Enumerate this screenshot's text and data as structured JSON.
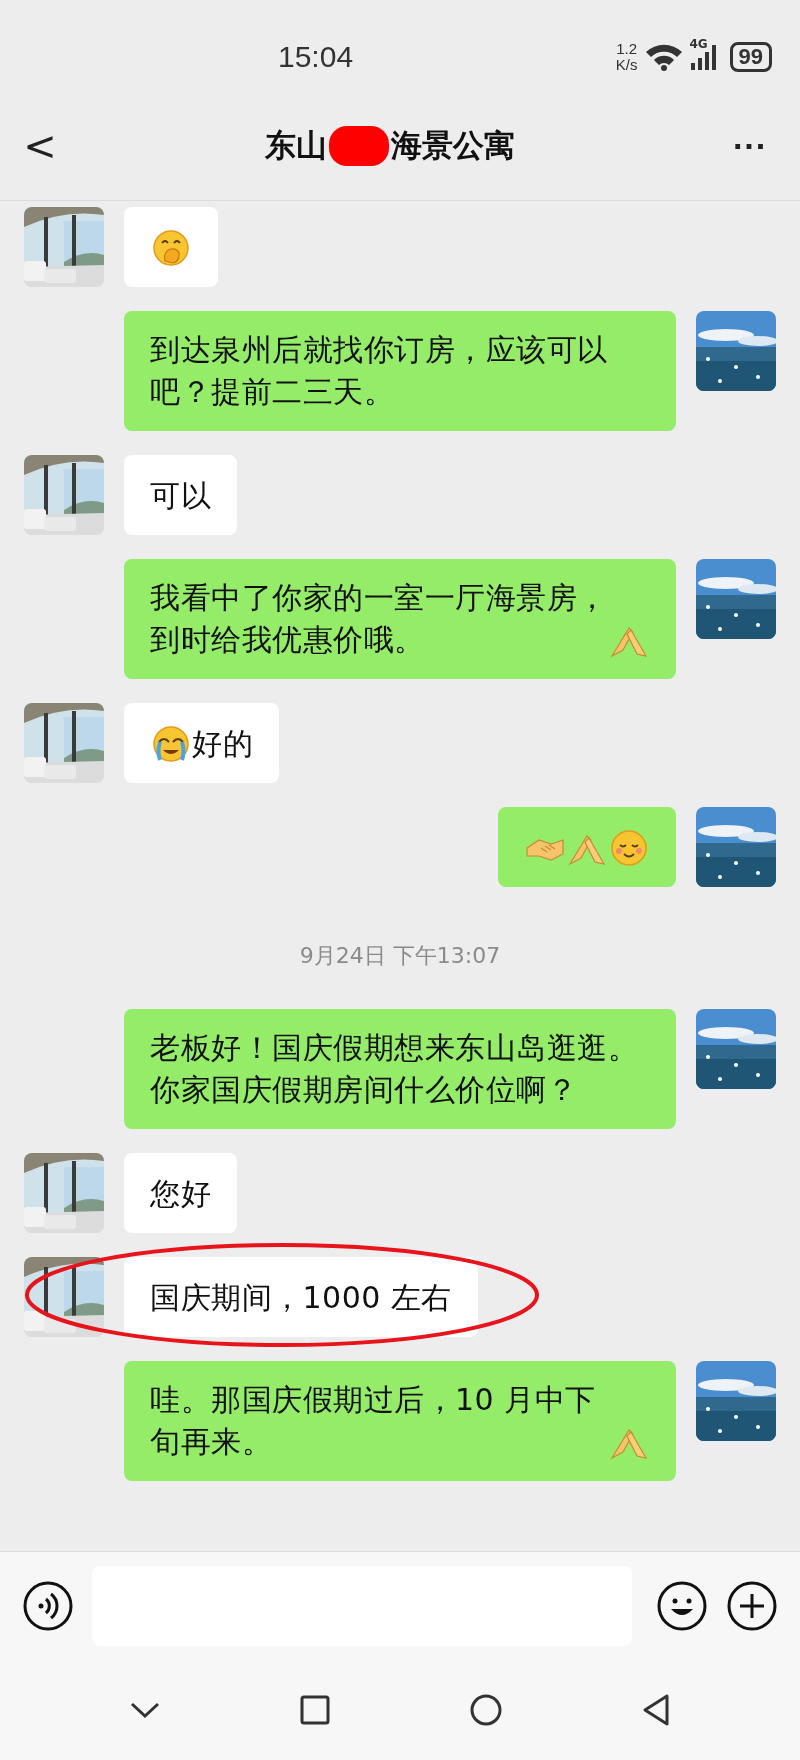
{
  "status_bar": {
    "time": "15:04",
    "speed_value": "1.2",
    "speed_unit": "K/s",
    "network": "4G",
    "battery": "99"
  },
  "header": {
    "back": "<",
    "title_start": "东山",
    "title_redacted": true,
    "title_end": "海景公寓",
    "more": "···"
  },
  "chat": [
    {
      "kind": "incoming",
      "parts": [
        {
          "kind": "cover-mouth"
        }
      ]
    },
    {
      "kind": "outgoing",
      "parts": [
        {
          "kind": "text",
          "text": "到达泉州后就找你订房，应该可以吧？提前二三天。"
        }
      ]
    },
    {
      "kind": "incoming",
      "parts": [
        {
          "kind": "text",
          "text": "可以"
        }
      ]
    },
    {
      "kind": "outgoing",
      "parts": [
        {
          "kind": "text",
          "text": "我看中了你家的一室一厅海景房，到时给我优惠价哦。"
        },
        {
          "kind": "pray"
        }
      ]
    },
    {
      "kind": "incoming",
      "parts": [
        {
          "kind": "cry"
        },
        {
          "kind": "text",
          "text": "好的"
        }
      ]
    },
    {
      "kind": "outgoing",
      "parts": [
        {
          "kind": "handshake"
        },
        {
          "kind": "pray"
        },
        {
          "kind": "blush"
        }
      ]
    },
    {
      "kind": "time",
      "text": "9月24日 下午13:07"
    },
    {
      "kind": "outgoing",
      "parts": [
        {
          "kind": "text",
          "text": "老板好！国庆假期想来东山岛逛逛。你家国庆假期房间什么价位啊？"
        }
      ]
    },
    {
      "kind": "incoming",
      "parts": [
        {
          "kind": "text",
          "text": "您好"
        }
      ]
    },
    {
      "kind": "incoming",
      "circled": true,
      "parts": [
        {
          "kind": "text",
          "text": "国庆期间，1000 左右"
        }
      ]
    },
    {
      "kind": "outgoing",
      "parts": [
        {
          "kind": "text",
          "text": "哇。那国庆假期过后，10 月中下旬再来。"
        },
        {
          "kind": "pray"
        }
      ]
    }
  ]
}
